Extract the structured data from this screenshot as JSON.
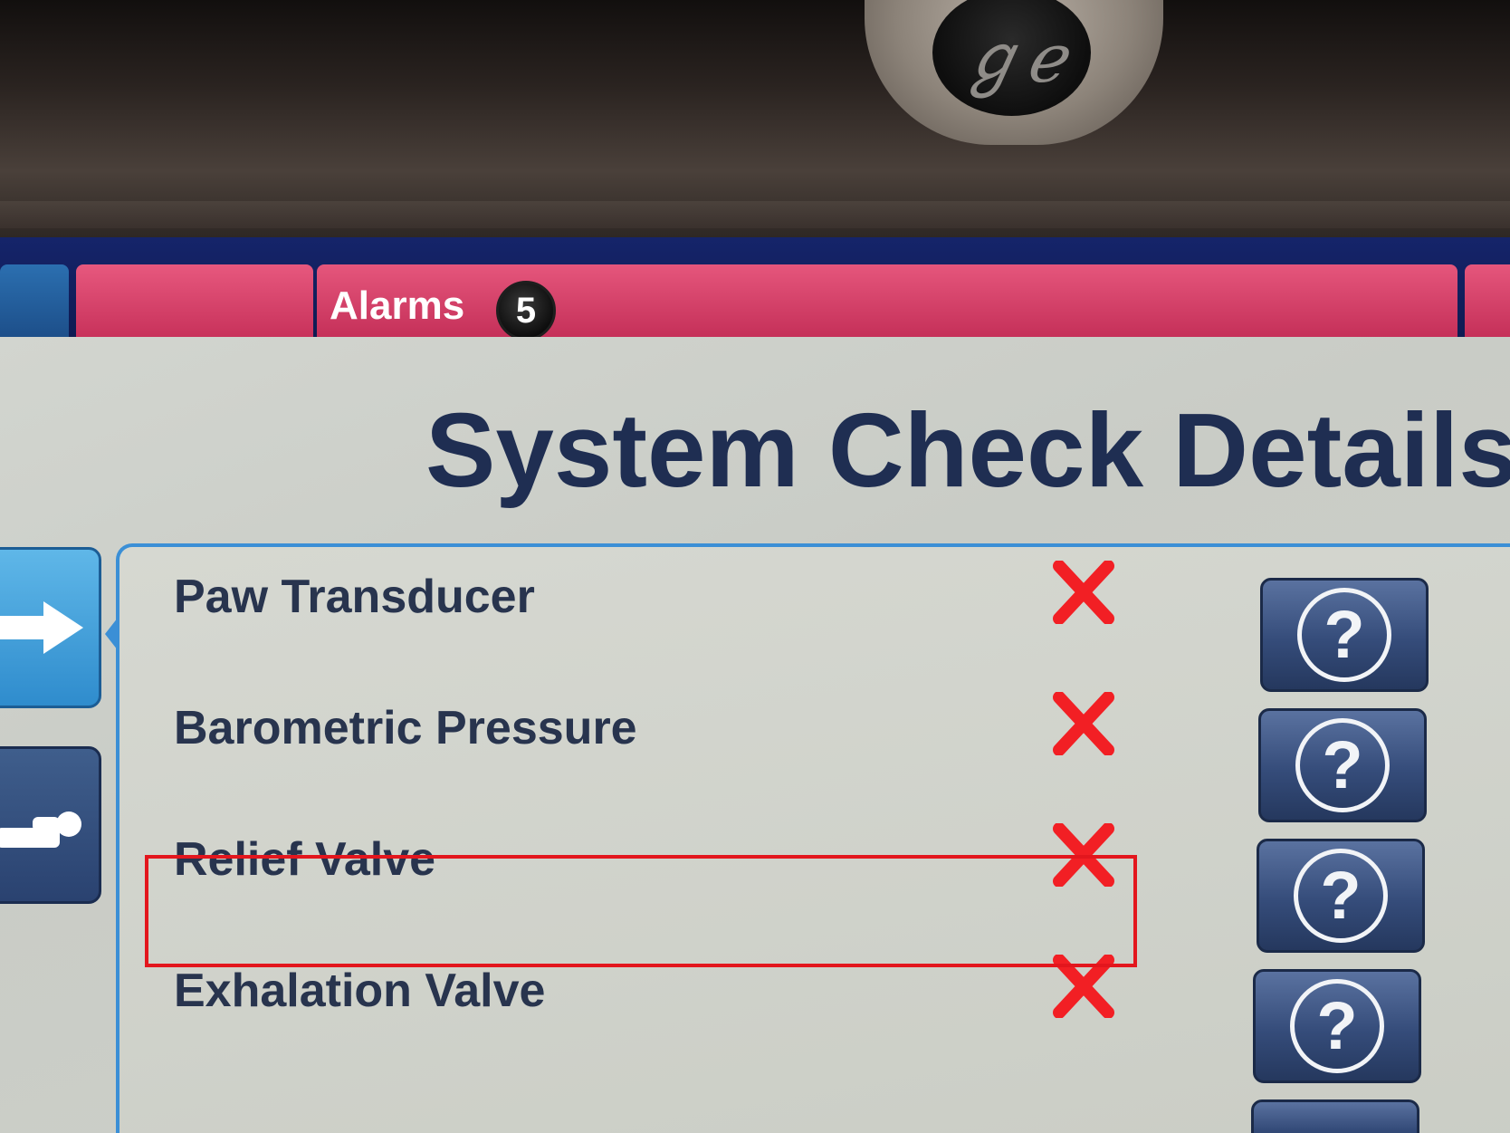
{
  "device": {
    "logo_icon": "ge-monogram-icon"
  },
  "tabs": {
    "alarms_label": "Alarms",
    "alarms_count": "5"
  },
  "page": {
    "title": "System Check Details"
  },
  "checks": [
    {
      "label": "Paw Transducer",
      "status": "fail"
    },
    {
      "label": "Barometric Pressure",
      "status": "fail"
    },
    {
      "label": "Relief Valve",
      "status": "fail"
    },
    {
      "label": "Exhalation Valve",
      "status": "fail"
    }
  ],
  "icons": {
    "fail": "red-x-icon",
    "help": "question-mark-icon",
    "side_1": "arrow-right-icon",
    "side_2": "patient-icon"
  },
  "colors": {
    "tab_pink": "#d33d66",
    "tab_blue": "#2b6fb0",
    "title_text": "#1f2e52",
    "fail_red": "#f21f24",
    "highlight_red": "#e3161d",
    "panel_border": "#3b8fd6"
  }
}
